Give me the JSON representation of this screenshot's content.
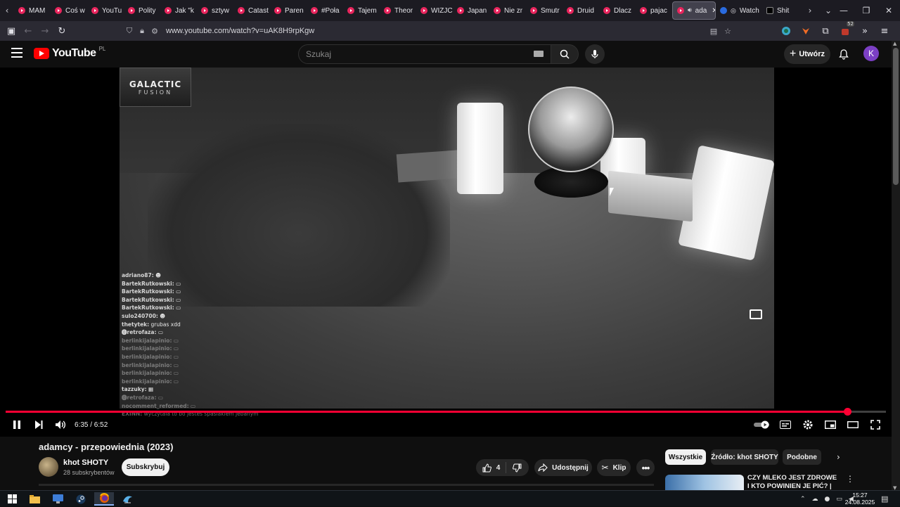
{
  "browser": {
    "tabs": [
      {
        "label": "MAM"
      },
      {
        "label": "Coś w"
      },
      {
        "label": "YouTu"
      },
      {
        "label": "Polity"
      },
      {
        "label": "Jak \"k"
      },
      {
        "label": "sztyw"
      },
      {
        "label": "Catast"
      },
      {
        "label": "Paren"
      },
      {
        "label": "#Poła"
      },
      {
        "label": "Tajem"
      },
      {
        "label": "Theor"
      },
      {
        "label": "WIZJC"
      },
      {
        "label": "Japan"
      },
      {
        "label": "Nie zr"
      },
      {
        "label": "Smutr"
      },
      {
        "label": "Druid"
      },
      {
        "label": "Dlacz"
      },
      {
        "label": "pajac"
      }
    ],
    "active_tab": {
      "label": "ada"
    },
    "extra_tabs": [
      {
        "label": "Watch"
      },
      {
        "label": "Shit"
      }
    ],
    "url": "www.youtube.com/watch?v=uAK8H9rpKgw",
    "extension_badge": "52"
  },
  "youtube": {
    "logo_text": "YouTube",
    "region": "PL",
    "search_placeholder": "Szukaj",
    "create_label": "Utwórz",
    "avatar_letter": "K"
  },
  "player": {
    "overlay_logo_line1": "GALACTIC",
    "overlay_logo_line2": "FUSION",
    "time_display": "6:35 / 6:52",
    "progress_fraction": 0.9563,
    "chat": [
      {
        "user": "adriano87:",
        "msg": "☻",
        "fade": false
      },
      {
        "user": "BartekRutkowski:",
        "msg": "▭",
        "fade": false
      },
      {
        "user": "BartekRutkowski:",
        "msg": "▭",
        "fade": false
      },
      {
        "user": "BartekRutkowski:",
        "msg": "▭",
        "fade": false
      },
      {
        "user": "BartekRutkowski:",
        "msg": "▭",
        "fade": false
      },
      {
        "user": "sulo240700:",
        "msg": "☻",
        "fade": false
      },
      {
        "user": "thetytek:",
        "msg": "grubas xdd",
        "fade": false
      },
      {
        "user": "⓿retrofaza:",
        "msg": "▭",
        "fade": false
      },
      {
        "user": "berlinkijalapinio:",
        "msg": "▭",
        "fade": true
      },
      {
        "user": "berlinkijalapinio:",
        "msg": "▭",
        "fade": true
      },
      {
        "user": "berlinkijalapinio:",
        "msg": "▭",
        "fade": true
      },
      {
        "user": "berlinkijalapinio:",
        "msg": "▭",
        "fade": true
      },
      {
        "user": "berlinkijalapinio:",
        "msg": "▭",
        "fade": true
      },
      {
        "user": "berlinkijalapinio:",
        "msg": "▭",
        "fade": true
      },
      {
        "user": "tazzuky:",
        "msg": "▦",
        "fade": false
      },
      {
        "user": "⓿retrofaza:",
        "msg": "▭",
        "fade": true
      },
      {
        "user": "nocomment_reformed:",
        "msg": "▭",
        "fade": true
      },
      {
        "user": "EXINN:",
        "msg": "wyczytala to bo jestes spaslakiem jebanym",
        "fade": true
      }
    ]
  },
  "video": {
    "title": "adamcy - przepowiednia (2023)",
    "channel": "khot SHOTY",
    "subscribers": "28 subskrybentów",
    "subscribe_label": "Subskrybuj",
    "like_count": "4",
    "share_label": "Udostępnij",
    "clip_label": "Klip"
  },
  "sidebar": {
    "chips": [
      {
        "label": "Wszystkie",
        "active": true
      },
      {
        "label": "Źródło: khot SHOTY",
        "active": false
      },
      {
        "label": "Podobne",
        "active": false
      }
    ],
    "rec_title": "CZY MLEKO JEST ZDROWE I KTO POWINIEN JE PIĆ? |"
  },
  "taskbar": {
    "time": "15:27",
    "date": "24.08.2025"
  }
}
